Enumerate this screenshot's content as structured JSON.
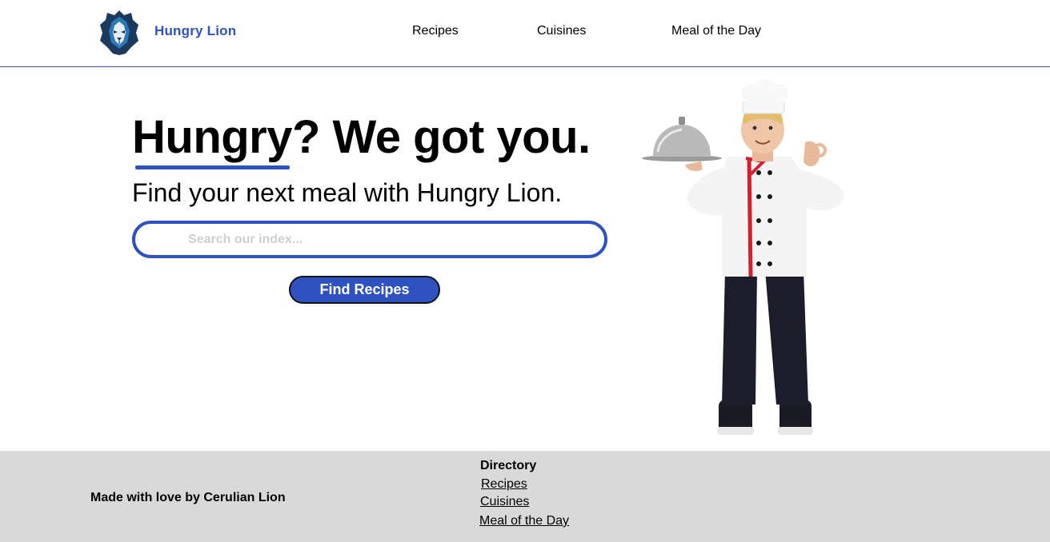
{
  "header": {
    "brand": "Hungry Lion",
    "logo_icon": "lion-head-icon",
    "nav": [
      {
        "label": "Recipes"
      },
      {
        "label": "Cuisines"
      },
      {
        "label": "Meal of the Day"
      }
    ]
  },
  "hero": {
    "title": "Hungry? We got you.",
    "subtitle": "Find your next meal with Hungry Lion.",
    "search_placeholder": "Search our index...",
    "search_value": "",
    "button_label": "Find Recipes",
    "illustration_icon": "chef-illustration"
  },
  "footer": {
    "credit": "Made with love by Cerulian Lion",
    "directory_heading": "Directory",
    "links": [
      {
        "label": "Recipes"
      },
      {
        "label": "Cuisines"
      },
      {
        "label": "Meal of the Day"
      }
    ]
  },
  "colors": {
    "accent": "#2f52c1",
    "footer_bg": "#d9d9d9",
    "text": "#000000",
    "placeholder": "#cfcfcf"
  }
}
